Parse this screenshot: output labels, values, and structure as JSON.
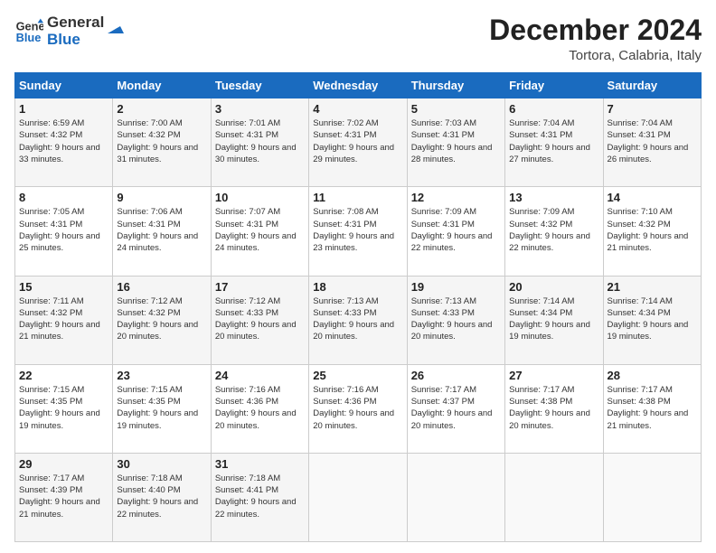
{
  "header": {
    "logo_line1": "General",
    "logo_line2": "Blue",
    "month_title": "December 2024",
    "location": "Tortora, Calabria, Italy"
  },
  "weekdays": [
    "Sunday",
    "Monday",
    "Tuesday",
    "Wednesday",
    "Thursday",
    "Friday",
    "Saturday"
  ],
  "weeks": [
    [
      {
        "day": "1",
        "sunrise": "Sunrise: 6:59 AM",
        "sunset": "Sunset: 4:32 PM",
        "daylight": "Daylight: 9 hours and 33 minutes."
      },
      {
        "day": "2",
        "sunrise": "Sunrise: 7:00 AM",
        "sunset": "Sunset: 4:32 PM",
        "daylight": "Daylight: 9 hours and 31 minutes."
      },
      {
        "day": "3",
        "sunrise": "Sunrise: 7:01 AM",
        "sunset": "Sunset: 4:31 PM",
        "daylight": "Daylight: 9 hours and 30 minutes."
      },
      {
        "day": "4",
        "sunrise": "Sunrise: 7:02 AM",
        "sunset": "Sunset: 4:31 PM",
        "daylight": "Daylight: 9 hours and 29 minutes."
      },
      {
        "day": "5",
        "sunrise": "Sunrise: 7:03 AM",
        "sunset": "Sunset: 4:31 PM",
        "daylight": "Daylight: 9 hours and 28 minutes."
      },
      {
        "day": "6",
        "sunrise": "Sunrise: 7:04 AM",
        "sunset": "Sunset: 4:31 PM",
        "daylight": "Daylight: 9 hours and 27 minutes."
      },
      {
        "day": "7",
        "sunrise": "Sunrise: 7:04 AM",
        "sunset": "Sunset: 4:31 PM",
        "daylight": "Daylight: 9 hours and 26 minutes."
      }
    ],
    [
      {
        "day": "8",
        "sunrise": "Sunrise: 7:05 AM",
        "sunset": "Sunset: 4:31 PM",
        "daylight": "Daylight: 9 hours and 25 minutes."
      },
      {
        "day": "9",
        "sunrise": "Sunrise: 7:06 AM",
        "sunset": "Sunset: 4:31 PM",
        "daylight": "Daylight: 9 hours and 24 minutes."
      },
      {
        "day": "10",
        "sunrise": "Sunrise: 7:07 AM",
        "sunset": "Sunset: 4:31 PM",
        "daylight": "Daylight: 9 hours and 24 minutes."
      },
      {
        "day": "11",
        "sunrise": "Sunrise: 7:08 AM",
        "sunset": "Sunset: 4:31 PM",
        "daylight": "Daylight: 9 hours and 23 minutes."
      },
      {
        "day": "12",
        "sunrise": "Sunrise: 7:09 AM",
        "sunset": "Sunset: 4:31 PM",
        "daylight": "Daylight: 9 hours and 22 minutes."
      },
      {
        "day": "13",
        "sunrise": "Sunrise: 7:09 AM",
        "sunset": "Sunset: 4:32 PM",
        "daylight": "Daylight: 9 hours and 22 minutes."
      },
      {
        "day": "14",
        "sunrise": "Sunrise: 7:10 AM",
        "sunset": "Sunset: 4:32 PM",
        "daylight": "Daylight: 9 hours and 21 minutes."
      }
    ],
    [
      {
        "day": "15",
        "sunrise": "Sunrise: 7:11 AM",
        "sunset": "Sunset: 4:32 PM",
        "daylight": "Daylight: 9 hours and 21 minutes."
      },
      {
        "day": "16",
        "sunrise": "Sunrise: 7:12 AM",
        "sunset": "Sunset: 4:32 PM",
        "daylight": "Daylight: 9 hours and 20 minutes."
      },
      {
        "day": "17",
        "sunrise": "Sunrise: 7:12 AM",
        "sunset": "Sunset: 4:33 PM",
        "daylight": "Daylight: 9 hours and 20 minutes."
      },
      {
        "day": "18",
        "sunrise": "Sunrise: 7:13 AM",
        "sunset": "Sunset: 4:33 PM",
        "daylight": "Daylight: 9 hours and 20 minutes."
      },
      {
        "day": "19",
        "sunrise": "Sunrise: 7:13 AM",
        "sunset": "Sunset: 4:33 PM",
        "daylight": "Daylight: 9 hours and 20 minutes."
      },
      {
        "day": "20",
        "sunrise": "Sunrise: 7:14 AM",
        "sunset": "Sunset: 4:34 PM",
        "daylight": "Daylight: 9 hours and 19 minutes."
      },
      {
        "day": "21",
        "sunrise": "Sunrise: 7:14 AM",
        "sunset": "Sunset: 4:34 PM",
        "daylight": "Daylight: 9 hours and 19 minutes."
      }
    ],
    [
      {
        "day": "22",
        "sunrise": "Sunrise: 7:15 AM",
        "sunset": "Sunset: 4:35 PM",
        "daylight": "Daylight: 9 hours and 19 minutes."
      },
      {
        "day": "23",
        "sunrise": "Sunrise: 7:15 AM",
        "sunset": "Sunset: 4:35 PM",
        "daylight": "Daylight: 9 hours and 19 minutes."
      },
      {
        "day": "24",
        "sunrise": "Sunrise: 7:16 AM",
        "sunset": "Sunset: 4:36 PM",
        "daylight": "Daylight: 9 hours and 20 minutes."
      },
      {
        "day": "25",
        "sunrise": "Sunrise: 7:16 AM",
        "sunset": "Sunset: 4:36 PM",
        "daylight": "Daylight: 9 hours and 20 minutes."
      },
      {
        "day": "26",
        "sunrise": "Sunrise: 7:17 AM",
        "sunset": "Sunset: 4:37 PM",
        "daylight": "Daylight: 9 hours and 20 minutes."
      },
      {
        "day": "27",
        "sunrise": "Sunrise: 7:17 AM",
        "sunset": "Sunset: 4:38 PM",
        "daylight": "Daylight: 9 hours and 20 minutes."
      },
      {
        "day": "28",
        "sunrise": "Sunrise: 7:17 AM",
        "sunset": "Sunset: 4:38 PM",
        "daylight": "Daylight: 9 hours and 21 minutes."
      }
    ],
    [
      {
        "day": "29",
        "sunrise": "Sunrise: 7:17 AM",
        "sunset": "Sunset: 4:39 PM",
        "daylight": "Daylight: 9 hours and 21 minutes."
      },
      {
        "day": "30",
        "sunrise": "Sunrise: 7:18 AM",
        "sunset": "Sunset: 4:40 PM",
        "daylight": "Daylight: 9 hours and 22 minutes."
      },
      {
        "day": "31",
        "sunrise": "Sunrise: 7:18 AM",
        "sunset": "Sunset: 4:41 PM",
        "daylight": "Daylight: 9 hours and 22 minutes."
      },
      null,
      null,
      null,
      null
    ]
  ]
}
